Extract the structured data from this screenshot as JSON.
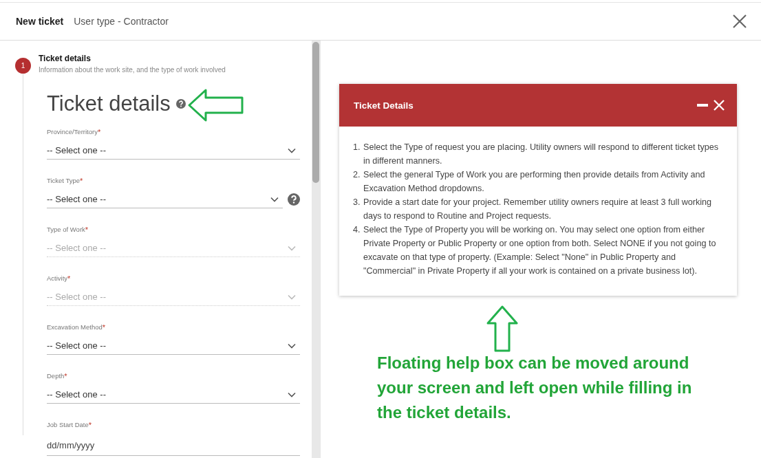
{
  "header": {
    "title": "New ticket",
    "subtitle": "User type - Contractor"
  },
  "step": {
    "number": "1",
    "title": "Ticket details",
    "description": "Information about the work site, and the type of work involved"
  },
  "form": {
    "heading": "Ticket details",
    "fields": [
      {
        "kind": "select",
        "label": "Province/Territory",
        "required_mark": "*",
        "placeholder": "-- Select one --",
        "disabled": false,
        "help": false
      },
      {
        "kind": "select",
        "label": "Ticket Type",
        "required_mark": "*",
        "placeholder": "-- Select one --",
        "disabled": false,
        "help": true
      },
      {
        "kind": "select",
        "label": "Type of Work",
        "required_mark": "*",
        "placeholder": "-- Select one --",
        "disabled": true,
        "help": false
      },
      {
        "kind": "select",
        "label": "Activity",
        "required_mark": "*",
        "placeholder": "-- Select one --",
        "disabled": true,
        "help": false
      },
      {
        "kind": "select",
        "label": "Excavation Method",
        "required_mark": "*",
        "placeholder": "-- Select one --",
        "disabled": false,
        "help": false
      },
      {
        "kind": "select",
        "label": "Depth",
        "required_mark": "*",
        "placeholder": "-- Select one --",
        "disabled": false,
        "help": false
      },
      {
        "kind": "date",
        "label": "Job Start Date",
        "required_mark": "*",
        "placeholder": "dd/mm/yyyy",
        "disabled": false,
        "help": false
      }
    ]
  },
  "help_box": {
    "title": "Ticket Details",
    "items": [
      {
        "number": "1.",
        "text": "Select the Type of request you are placing. Utility owners will respond to different ticket types in different manners."
      },
      {
        "number": "2.",
        "text": "Select the general Type of Work you are performing then provide details from Activity and Excavation Method dropdowns."
      },
      {
        "number": "3.",
        "text": "Provide a start date for your project. Remember utility owners require at least 3 full working days to respond to Routine and Project requests."
      },
      {
        "number": "4.",
        "text": "Select the Type of Property you will be working on. You may select one option from either Private Property or Public Property or one option from both. Select NONE if you not going to excavate on that type of property. (Example: Select \"None\" in Public Property and \"Commercial\" in Private Property if all your work is contained on a private business lot)."
      }
    ]
  },
  "annotation": {
    "text": "Floating help box can be moved around your screen and left open while filling in the ticket details."
  }
}
